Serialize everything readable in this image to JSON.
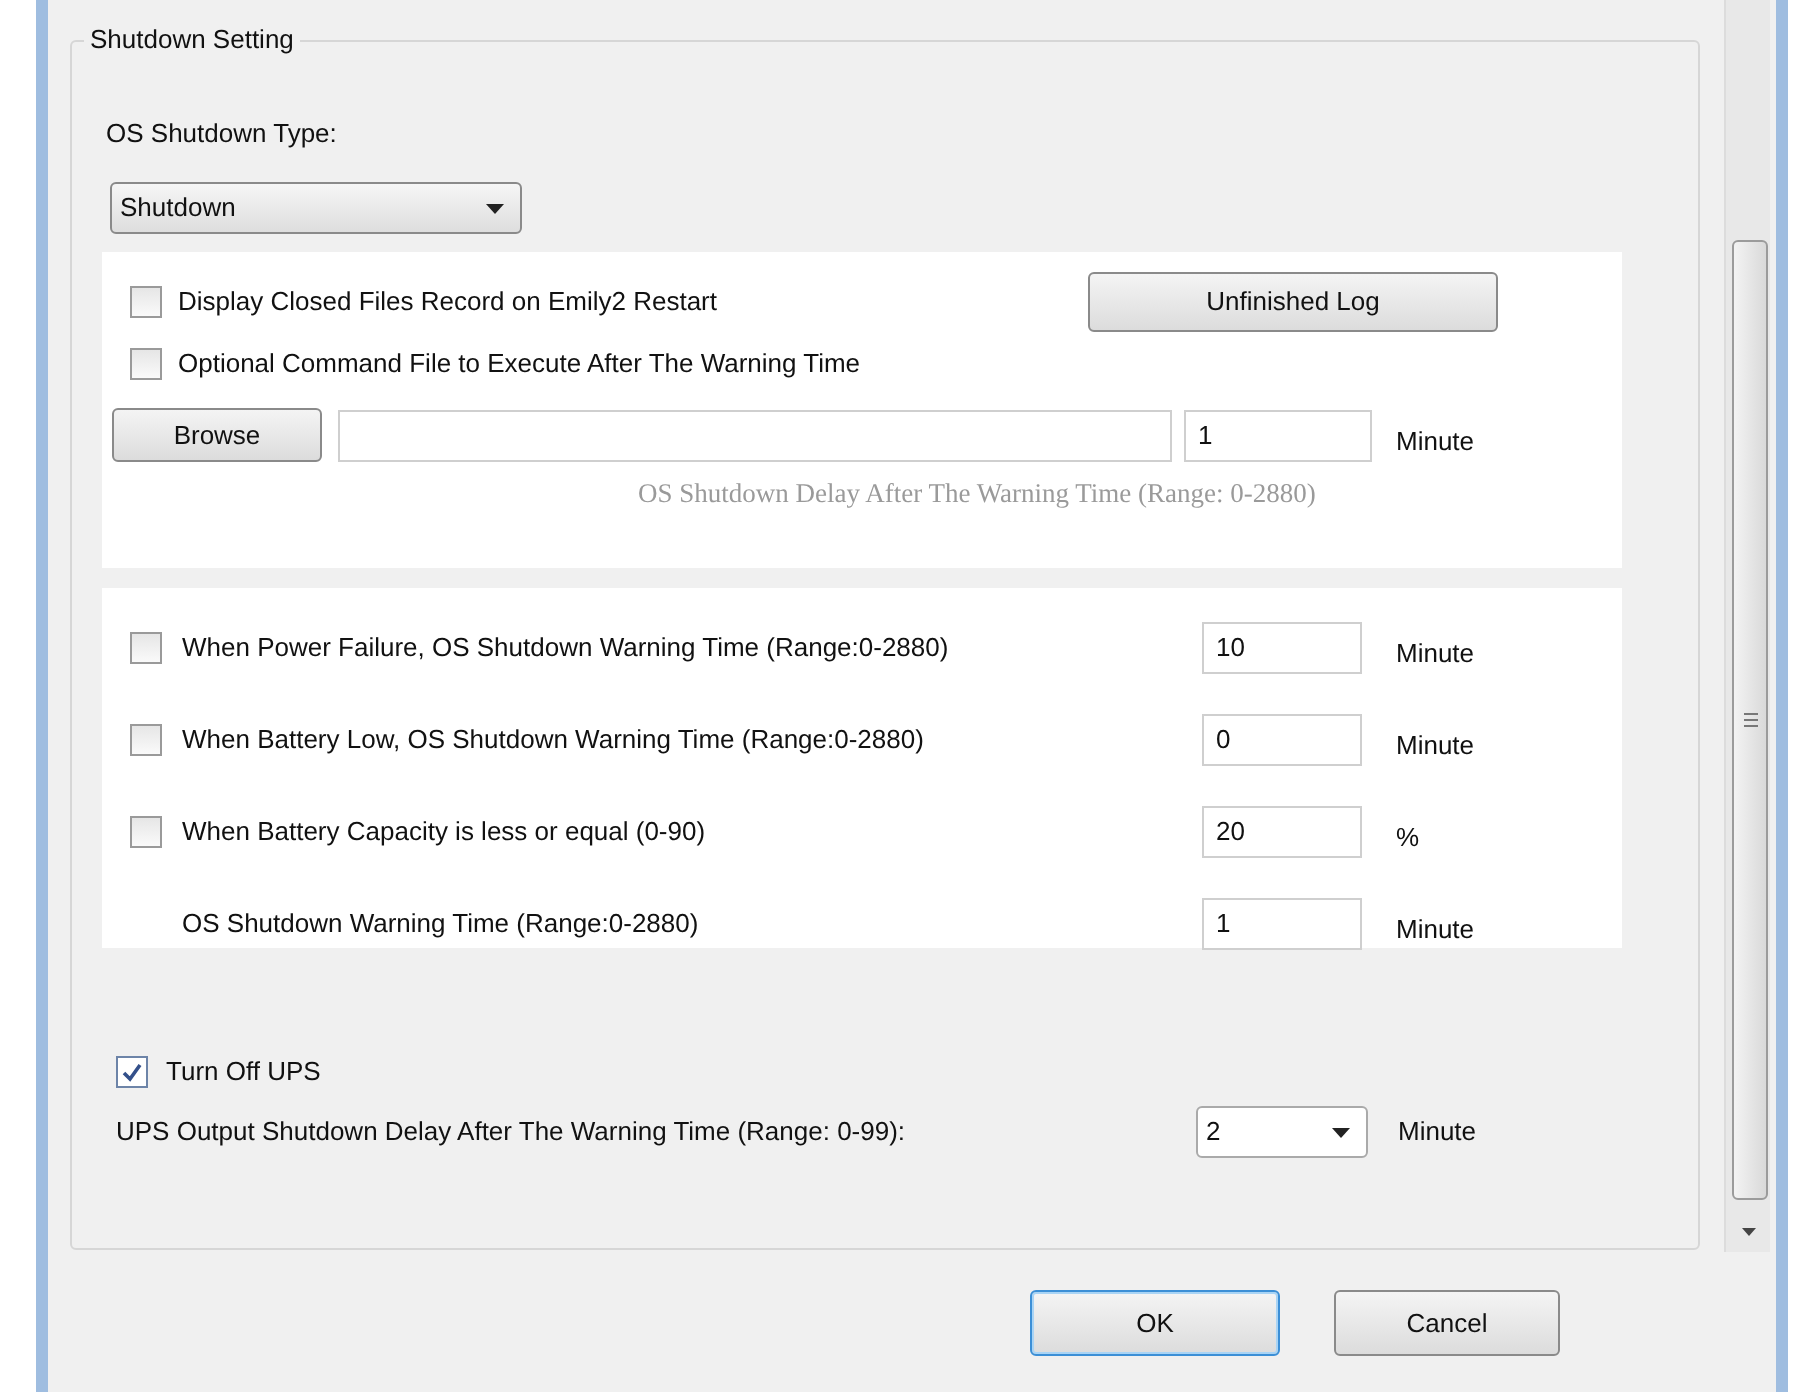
{
  "group_title": "Shutdown Setting",
  "shutdown_type": {
    "label": "OS Shutdown Type:",
    "value": "Shutdown"
  },
  "command_panel": {
    "options": [
      {
        "label": "Display Closed Files Record on Emily2 Restart",
        "checked": false
      },
      {
        "label": "Optional Command File to Execute After The Warning Time",
        "checked": false
      }
    ],
    "log_button": "Unfinished Log",
    "browse_button": "Browse",
    "delay_value": "1",
    "delay_unit": "Minute",
    "delay_hint": "OS Shutdown Delay After The Warning Time (Range: 0-2880)"
  },
  "warning_rows": [
    {
      "kind": "checkbox",
      "label": "When Power Failure, OS Shutdown Warning Time (Range:0-2880)",
      "checked": false,
      "value": "10",
      "unit": "Minute"
    },
    {
      "kind": "checkbox",
      "label": "When Battery Low, OS Shutdown Warning Time (Range:0-2880)",
      "checked": false,
      "value": "0",
      "unit": "Minute"
    },
    {
      "kind": "checkbox",
      "label": "When Battery Capacity is less or equal (0-90)",
      "checked": false,
      "value": "20",
      "unit": "%"
    },
    {
      "kind": "plain",
      "label": "OS Shutdown Warning Time (Range:0-2880)",
      "value": "1",
      "unit": "Minute"
    }
  ],
  "ups": {
    "turn_off": {
      "label": "Turn Off UPS",
      "checked": true
    },
    "delay_label": "UPS Output Shutdown Delay After The Warning Time (Range: 0-99):",
    "delay_value": "2",
    "delay_unit": "Minute"
  },
  "buttons": [
    {
      "label": "OK",
      "default": true
    },
    {
      "label": "Cancel",
      "default": false
    }
  ]
}
